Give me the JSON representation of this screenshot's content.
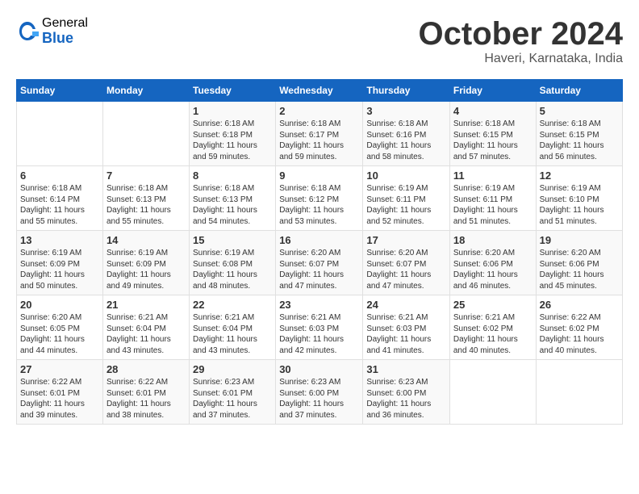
{
  "header": {
    "logo_general": "General",
    "logo_blue": "Blue",
    "month_title": "October 2024",
    "location": "Haveri, Karnataka, India"
  },
  "calendar": {
    "days_of_week": [
      "Sunday",
      "Monday",
      "Tuesday",
      "Wednesday",
      "Thursday",
      "Friday",
      "Saturday"
    ],
    "weeks": [
      [
        {
          "day": "",
          "info": ""
        },
        {
          "day": "",
          "info": ""
        },
        {
          "day": "1",
          "info": "Sunrise: 6:18 AM\nSunset: 6:18 PM\nDaylight: 11 hours\nand 59 minutes."
        },
        {
          "day": "2",
          "info": "Sunrise: 6:18 AM\nSunset: 6:17 PM\nDaylight: 11 hours\nand 59 minutes."
        },
        {
          "day": "3",
          "info": "Sunrise: 6:18 AM\nSunset: 6:16 PM\nDaylight: 11 hours\nand 58 minutes."
        },
        {
          "day": "4",
          "info": "Sunrise: 6:18 AM\nSunset: 6:15 PM\nDaylight: 11 hours\nand 57 minutes."
        },
        {
          "day": "5",
          "info": "Sunrise: 6:18 AM\nSunset: 6:15 PM\nDaylight: 11 hours\nand 56 minutes."
        }
      ],
      [
        {
          "day": "6",
          "info": "Sunrise: 6:18 AM\nSunset: 6:14 PM\nDaylight: 11 hours\nand 55 minutes."
        },
        {
          "day": "7",
          "info": "Sunrise: 6:18 AM\nSunset: 6:13 PM\nDaylight: 11 hours\nand 55 minutes."
        },
        {
          "day": "8",
          "info": "Sunrise: 6:18 AM\nSunset: 6:13 PM\nDaylight: 11 hours\nand 54 minutes."
        },
        {
          "day": "9",
          "info": "Sunrise: 6:18 AM\nSunset: 6:12 PM\nDaylight: 11 hours\nand 53 minutes."
        },
        {
          "day": "10",
          "info": "Sunrise: 6:19 AM\nSunset: 6:11 PM\nDaylight: 11 hours\nand 52 minutes."
        },
        {
          "day": "11",
          "info": "Sunrise: 6:19 AM\nSunset: 6:11 PM\nDaylight: 11 hours\nand 51 minutes."
        },
        {
          "day": "12",
          "info": "Sunrise: 6:19 AM\nSunset: 6:10 PM\nDaylight: 11 hours\nand 51 minutes."
        }
      ],
      [
        {
          "day": "13",
          "info": "Sunrise: 6:19 AM\nSunset: 6:09 PM\nDaylight: 11 hours\nand 50 minutes."
        },
        {
          "day": "14",
          "info": "Sunrise: 6:19 AM\nSunset: 6:09 PM\nDaylight: 11 hours\nand 49 minutes."
        },
        {
          "day": "15",
          "info": "Sunrise: 6:19 AM\nSunset: 6:08 PM\nDaylight: 11 hours\nand 48 minutes."
        },
        {
          "day": "16",
          "info": "Sunrise: 6:20 AM\nSunset: 6:07 PM\nDaylight: 11 hours\nand 47 minutes."
        },
        {
          "day": "17",
          "info": "Sunrise: 6:20 AM\nSunset: 6:07 PM\nDaylight: 11 hours\nand 47 minutes."
        },
        {
          "day": "18",
          "info": "Sunrise: 6:20 AM\nSunset: 6:06 PM\nDaylight: 11 hours\nand 46 minutes."
        },
        {
          "day": "19",
          "info": "Sunrise: 6:20 AM\nSunset: 6:06 PM\nDaylight: 11 hours\nand 45 minutes."
        }
      ],
      [
        {
          "day": "20",
          "info": "Sunrise: 6:20 AM\nSunset: 6:05 PM\nDaylight: 11 hours\nand 44 minutes."
        },
        {
          "day": "21",
          "info": "Sunrise: 6:21 AM\nSunset: 6:04 PM\nDaylight: 11 hours\nand 43 minutes."
        },
        {
          "day": "22",
          "info": "Sunrise: 6:21 AM\nSunset: 6:04 PM\nDaylight: 11 hours\nand 43 minutes."
        },
        {
          "day": "23",
          "info": "Sunrise: 6:21 AM\nSunset: 6:03 PM\nDaylight: 11 hours\nand 42 minutes."
        },
        {
          "day": "24",
          "info": "Sunrise: 6:21 AM\nSunset: 6:03 PM\nDaylight: 11 hours\nand 41 minutes."
        },
        {
          "day": "25",
          "info": "Sunrise: 6:21 AM\nSunset: 6:02 PM\nDaylight: 11 hours\nand 40 minutes."
        },
        {
          "day": "26",
          "info": "Sunrise: 6:22 AM\nSunset: 6:02 PM\nDaylight: 11 hours\nand 40 minutes."
        }
      ],
      [
        {
          "day": "27",
          "info": "Sunrise: 6:22 AM\nSunset: 6:01 PM\nDaylight: 11 hours\nand 39 minutes."
        },
        {
          "day": "28",
          "info": "Sunrise: 6:22 AM\nSunset: 6:01 PM\nDaylight: 11 hours\nand 38 minutes."
        },
        {
          "day": "29",
          "info": "Sunrise: 6:23 AM\nSunset: 6:01 PM\nDaylight: 11 hours\nand 37 minutes."
        },
        {
          "day": "30",
          "info": "Sunrise: 6:23 AM\nSunset: 6:00 PM\nDaylight: 11 hours\nand 37 minutes."
        },
        {
          "day": "31",
          "info": "Sunrise: 6:23 AM\nSunset: 6:00 PM\nDaylight: 11 hours\nand 36 minutes."
        },
        {
          "day": "",
          "info": ""
        },
        {
          "day": "",
          "info": ""
        }
      ]
    ]
  }
}
